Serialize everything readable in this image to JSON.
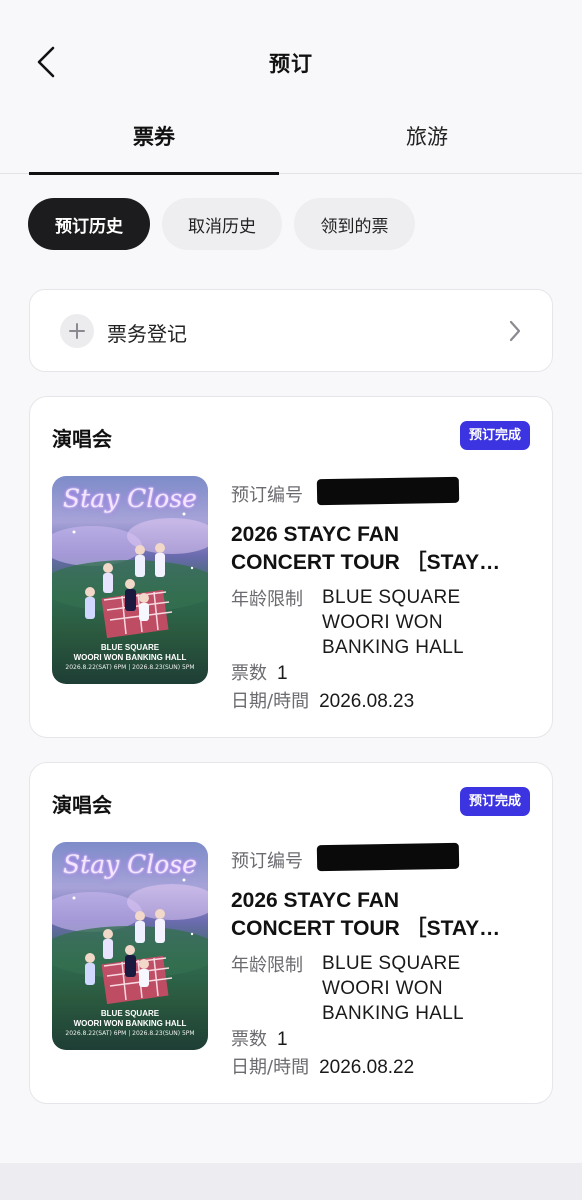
{
  "header": {
    "title": "预订",
    "back_icon": "chevron-left-icon"
  },
  "tabs": [
    {
      "label": "票券",
      "active": true
    },
    {
      "label": "旅游",
      "active": false
    }
  ],
  "filters": [
    {
      "label": "预订历史",
      "selected": true
    },
    {
      "label": "取消历史",
      "selected": false
    },
    {
      "label": "领到的票",
      "selected": false
    }
  ],
  "register": {
    "label": "票务登记",
    "icon": "plus-icon",
    "chevron": "chevron-right-icon"
  },
  "colors": {
    "badge": "#3b34e0",
    "selected_chip": "#1c1c1e",
    "background": "#f8f8fa"
  },
  "bookings": [
    {
      "type": "演唱会",
      "status": "预订完成",
      "booking_no_label": "预订编号",
      "title_line1": "2026 STAYC FAN",
      "title_line2": "CONCERT TOUR ［STAY…",
      "age_label": "年龄限制",
      "venue_line1": "BLUE SQUARE",
      "venue_line2": "WOORI WON",
      "venue_line3": "BANKING HALL",
      "count_label": "票数",
      "count": "1",
      "date_label": "日期/時間",
      "date": "2026.08.23",
      "poster": {
        "title": "Stay Close",
        "venue_line1": "BLUE SQUARE",
        "venue_line2": "WOORI WON BANKING HALL",
        "dates": "2026.8.22(SAT) 6PM | 2026.8.23(SUN) 5PM"
      }
    },
    {
      "type": "演唱会",
      "status": "预订完成",
      "booking_no_label": "预订编号",
      "title_line1": "2026 STAYC FAN",
      "title_line2": "CONCERT TOUR ［STAY…",
      "age_label": "年龄限制",
      "venue_line1": "BLUE SQUARE",
      "venue_line2": "WOORI WON",
      "venue_line3": "BANKING HALL",
      "count_label": "票数",
      "count": "1",
      "date_label": "日期/時間",
      "date": "2026.08.22",
      "poster": {
        "title": "Stay Close",
        "venue_line1": "BLUE SQUARE",
        "venue_line2": "WOORI WON BANKING HALL",
        "dates": "2026.8.22(SAT) 6PM | 2026.8.23(SUN) 5PM"
      }
    }
  ]
}
